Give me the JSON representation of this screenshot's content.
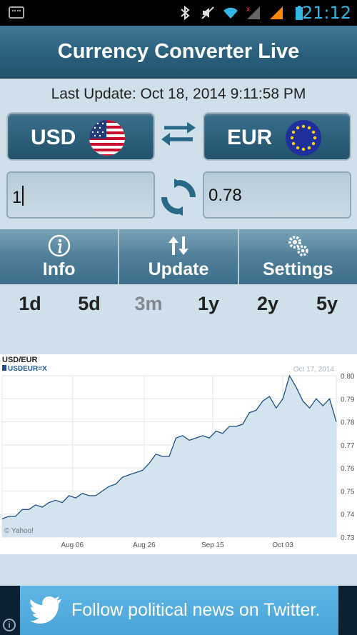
{
  "status_bar": {
    "time": "21:12"
  },
  "app": {
    "title": "Currency Converter Live"
  },
  "last_update": "Last Update: Oct 18, 2014 9:11:58 PM",
  "from_currency": {
    "code": "USD",
    "flag_icon": "us-flag-icon"
  },
  "to_currency": {
    "code": "EUR",
    "flag_icon": "eu-flag-icon"
  },
  "amount_input": {
    "value": "1"
  },
  "result": {
    "value": "0.78"
  },
  "actions": [
    {
      "label": "Info",
      "icon": "info-icon"
    },
    {
      "label": "Update",
      "icon": "update-arrows-icon"
    },
    {
      "label": "Settings",
      "icon": "gears-icon"
    }
  ],
  "ranges": [
    "1d",
    "5d",
    "3m",
    "1y",
    "2y",
    "5y"
  ],
  "active_range": "3m",
  "chart_data": {
    "type": "area",
    "title": "USD/EUR",
    "series": [
      {
        "name": "USDEUR=X",
        "values": [
          0.738,
          0.739,
          0.739,
          0.742,
          0.742,
          0.744,
          0.743,
          0.745,
          0.746,
          0.745,
          0.748,
          0.747,
          0.749,
          0.748,
          0.748,
          0.75,
          0.752,
          0.753,
          0.756,
          0.757,
          0.758,
          0.759,
          0.762,
          0.766,
          0.765,
          0.765,
          0.773,
          0.774,
          0.772,
          0.773,
          0.774,
          0.773,
          0.776,
          0.775,
          0.778,
          0.778,
          0.779,
          0.784,
          0.785,
          0.789,
          0.791,
          0.786,
          0.79,
          0.8,
          0.795,
          0.789,
          0.786,
          0.79,
          0.787,
          0.79,
          0.78
        ]
      }
    ],
    "x_ticks": [
      "Aug 06",
      "Aug 26",
      "Sep 15",
      "Oct 03"
    ],
    "y_ticks": [
      "0.80",
      "0.79",
      "0.78",
      "0.77",
      "0.76",
      "0.75",
      "0.74",
      "0.73"
    ],
    "ylim": [
      0.73,
      0.8
    ],
    "date_label": "Oct 17, 2014",
    "credit": "© Yahoo!",
    "colors": {
      "line": "#1f4f86",
      "fill": "#d4e4ef",
      "grid": "#dde6ec"
    }
  },
  "ad": {
    "text": "Follow political news on Twitter.",
    "icon": "twitter-bird-icon",
    "info_icon": "info-icon"
  }
}
